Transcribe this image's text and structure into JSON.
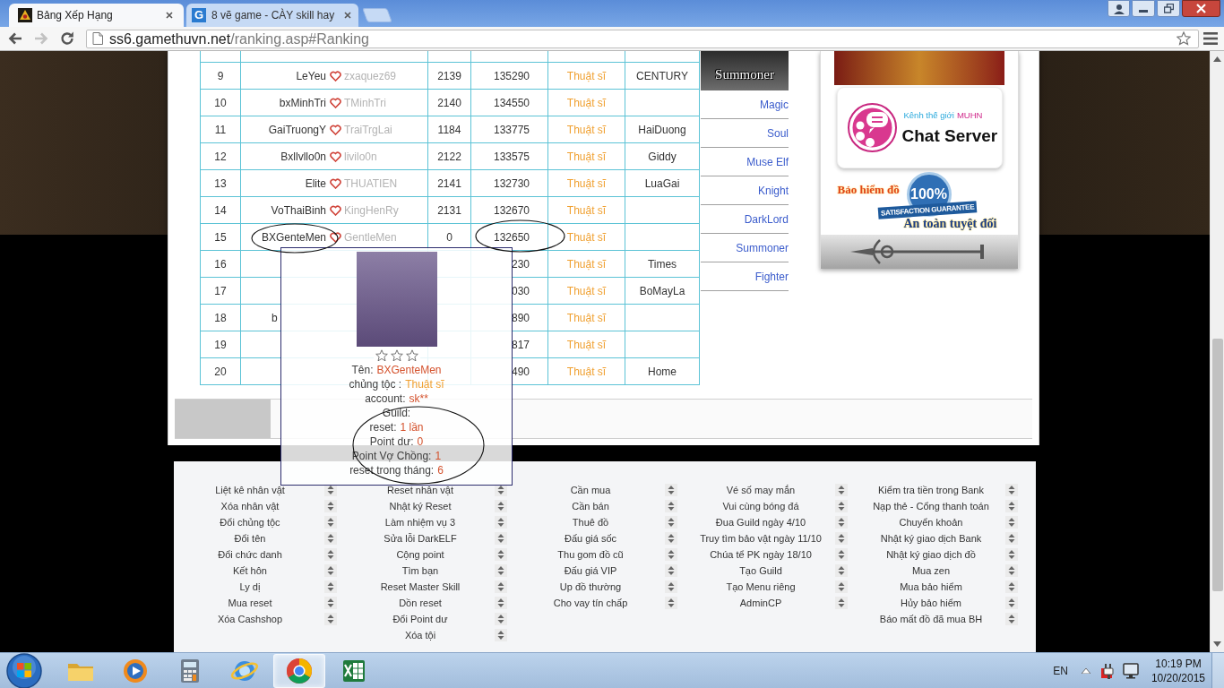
{
  "browser": {
    "tabs": [
      {
        "title": "Bảng Xếp Hạng",
        "selected": true,
        "favicon": {
          "kind": "game"
        }
      },
      {
        "title": "8 vẽ game - CÀY skill hay",
        "selected": false,
        "favicon": {
          "kind": "letter",
          "text": "G"
        }
      }
    ],
    "nav_buttons": [
      {
        "kind": "back",
        "disabled": false
      },
      {
        "kind": "forward",
        "disabled": true
      },
      {
        "kind": "reload",
        "disabled": false
      }
    ],
    "address": {
      "host": "ss6.gamethuvn.net",
      "path": "/ranking.asp#Ranking"
    }
  },
  "ranking_table": {
    "rows": [
      {
        "rank": "9",
        "name": "LeYeu",
        "account": "zxaquez69",
        "resets": "2139",
        "points": "135290",
        "class": "Thuật sĩ",
        "guild": "CENTURY"
      },
      {
        "rank": "10",
        "name": "bxMinhTri",
        "account": "TMinhTri",
        "resets": "2140",
        "points": "134550",
        "class": "Thuật sĩ"
      },
      {
        "rank": "11",
        "name": "GaiTruongY",
        "account": "TraiTrgLai",
        "resets": "1184",
        "points": "133775",
        "class": "Thuật sĩ",
        "guild": "HaiDuong"
      },
      {
        "rank": "12",
        "name": "Bxllvllo0n",
        "account": "livilo0n",
        "resets": "2122",
        "points": "133575",
        "class": "Thuật sĩ",
        "guild": "Giddy"
      },
      {
        "rank": "13",
        "name": "Elite",
        "account": "THUATIEN",
        "resets": "2141",
        "points": "132730",
        "class": "Thuật sĩ",
        "guild": "LuaGai"
      },
      {
        "rank": "14",
        "name": "VoThaiBinh",
        "account": "KingHenRy",
        "resets": "2131",
        "points": "132670",
        "class": "Thuật sĩ"
      },
      {
        "rank": "15",
        "name": "BXGenteMen",
        "account": "GentleMen",
        "resets": "0",
        "points": "132650",
        "class": "Thuật sĩ"
      },
      {
        "rank": "16",
        "points": "230",
        "class": "Thuật sĩ",
        "guild": "Times"
      },
      {
        "rank": "17",
        "points": "030",
        "class": "Thuật sĩ",
        "guild": "BoMayLa"
      },
      {
        "rank": "18",
        "name": "b",
        "points": "890",
        "class": "Thuật sĩ"
      },
      {
        "rank": "19",
        "points": "817",
        "class": "Thuật sĩ"
      },
      {
        "rank": "20",
        "points": "490",
        "class": "Thuật sĩ",
        "guild": "Home"
      }
    ]
  },
  "class_menu": {
    "banner_title": "Summoner",
    "items": [
      "Magic",
      "Soul",
      "Muse Elf",
      "Knight",
      "DarkLord",
      "Summoner",
      "Fighter"
    ]
  },
  "sidebar": {
    "chat_banner": {
      "subtitle": "Kênh thế giới",
      "highlight": "MUHN",
      "title": "Chat Server"
    },
    "insurance_banner": {
      "title": "Bảo hiểm đồ",
      "badge_value": "100%",
      "badge_caption": "SATISFACTION GUARANTEE",
      "slogan": "An toàn tuyệt đối"
    }
  },
  "character_popup": {
    "stars": 0,
    "lines": [
      {
        "label": "Tên:",
        "value": "BXGenteMen",
        "kind": "value"
      },
      {
        "label": "chủng tộc :",
        "value": "Thuật sĩ",
        "kind": "class"
      },
      {
        "label": "account:",
        "value": "sk**",
        "kind": "value"
      },
      {
        "label": "Guild:"
      },
      {
        "label": "reset:",
        "value": "1 lần",
        "kind": "value"
      },
      {
        "label": "Point dư:",
        "value": "0",
        "kind": "value"
      },
      {
        "label": "Point Vợ Chồng:",
        "value": "1",
        "kind": "value"
      },
      {
        "label": "reset trong tháng:",
        "value": "6",
        "kind": "value"
      }
    ]
  },
  "footer_menu": {
    "columns": [
      [
        "Liệt kê nhân vật",
        "Xóa nhân vật",
        "Đổi chủng tộc",
        "Đổi tên",
        "Đổi chức danh",
        "Kết hôn",
        "Ly dị",
        "Mua reset",
        "Xóa Cashshop"
      ],
      [
        "Reset nhân vật",
        "Nhật ký Reset",
        "Làm nhiệm vụ 3",
        "Sửa lỗi DarkELF",
        "Cộng point",
        "Tìm bạn",
        "Reset Master Skill",
        "Dồn reset",
        "Đổi Point dư",
        "Xóa tội"
      ],
      [
        "Cần mua",
        "Cần bán",
        "Thuê đồ",
        "Đấu giá sốc",
        "Thu gom đồ cũ",
        "Đấu giá VIP",
        "Up đồ thường",
        "Cho vay tín chấp"
      ],
      [
        "Vé số may mắn",
        "Vui cùng bóng đá",
        "Đua Guild ngày 4/10",
        "Truy tìm bảo vật ngày 11/10",
        "Chúa tể PK ngày 18/10",
        "Tạo Guild",
        "Tạo Menu riêng",
        "AdminCP"
      ],
      [
        "Kiểm tra tiền trong Bank",
        "Nạp thẻ - Cổng thanh toán",
        "Chuyển khoản",
        "Nhật ký giao dịch Bank",
        "Nhật ký giao dịch đồ",
        "Mua zen",
        "Mua bảo hiểm",
        "Hủy bảo hiểm",
        "Báo mất đồ đã mua BH"
      ]
    ]
  },
  "taskbar": {
    "apps": [
      {
        "kind": "folder",
        "selected": false
      },
      {
        "kind": "media",
        "selected": false
      },
      {
        "kind": "calculator",
        "selected": false
      },
      {
        "kind": "globe",
        "selected": false
      },
      {
        "kind": "wheel",
        "selected": true
      },
      {
        "kind": "spreadsheet",
        "selected": false
      }
    ],
    "language": "EN",
    "clock": {
      "time": "10:19 PM",
      "date": "10/20/2015"
    }
  }
}
